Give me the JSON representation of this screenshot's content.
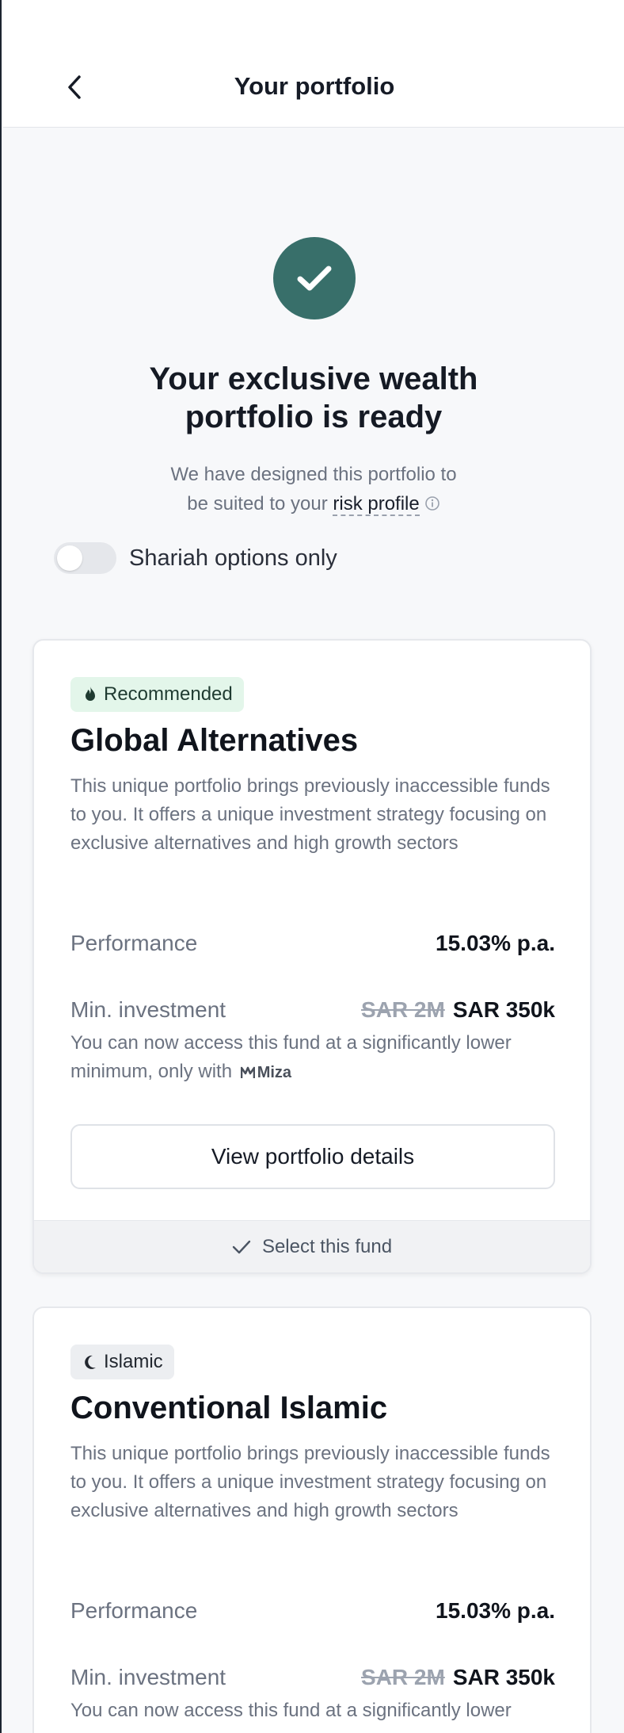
{
  "header": {
    "title": "Your portfolio"
  },
  "hero": {
    "title_line1": "Your exclusive wealth",
    "title_line2": "portfolio is ready",
    "subtitle_line1": "We have designed this portfolio to",
    "subtitle_prefix": "be suited to your",
    "risk_link": "risk profile"
  },
  "toggle": {
    "label": "Shariah options only",
    "on": false
  },
  "cards": [
    {
      "badge": "Recommended",
      "badge_icon": "flame-icon",
      "title": "Global Alternatives",
      "description": "This unique portfolio brings previously inaccessible funds to you. It offers a unique investment strategy focusing on exclusive alternatives and high growth sectors",
      "performance_label": "Performance",
      "performance_value": "15.03% p.a.",
      "min_label": "Min. investment",
      "min_old": "SAR 2M",
      "min_new": "SAR 350k",
      "note_line1": "You can now access this fund at a significantly lower",
      "note_prefix": "minimum, only with",
      "brand": "Miza",
      "details_button": "View portfolio details",
      "select_label": "Select this fund"
    },
    {
      "badge": "Islamic",
      "badge_icon": "moon-icon",
      "title": "Conventional Islamic",
      "description": "This unique portfolio brings previously inaccessible funds to you. It offers a unique investment strategy focusing on exclusive alternatives and high growth sectors",
      "performance_label": "Performance",
      "performance_value": "15.03% p.a.",
      "min_label": "Min. investment",
      "min_old": "SAR 2M",
      "min_new": "SAR 350k",
      "note_line1": "You can now access this fund at a significantly lower"
    }
  ],
  "colors": {
    "accent": "#386f6a",
    "badge_green_bg": "#e3f6ea",
    "background": "#f7f8fa"
  }
}
